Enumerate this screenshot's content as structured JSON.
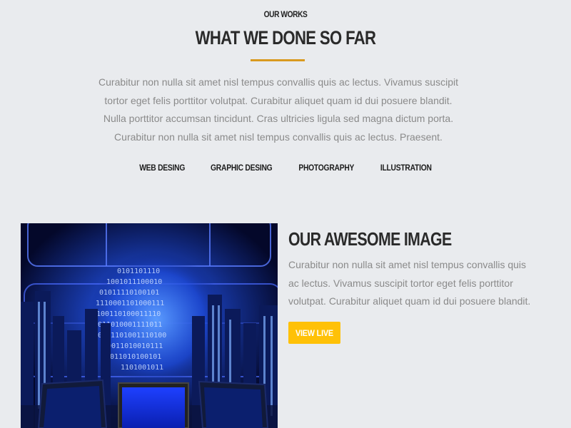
{
  "section": {
    "eyebrow": "OUR WORKS",
    "title": "WHAT WE DONE SO FAR",
    "intro": "Curabitur non nulla sit amet nisl tempus convallis quis ac lectus. Vivamus suscipit tortor eget felis porttitor volutpat. Curabitur aliquet quam id dui posuere blandit. Nulla porttitor accumsan tincidunt. Cras ultricies ligula sed magna dictum porta. Curabitur non nulla sit amet nisl tempus convallis quis ac lectus. Praesent."
  },
  "filters": [
    "WEB DESING",
    "GRAPHIC DESING",
    "PHOTOGRAPHY",
    "ILLUSTRATION"
  ],
  "feature": {
    "title": "OUR AWESOME IMAGE",
    "text": "Curabitur non nulla sit amet nisl tempus convallis quis ac lectus. Vivamus suscipit tortor eget felis porttitor volutpat. Curabitur aliquet quam id dui posuere blandit.",
    "button_label": "VIEW LIVE",
    "image_subject": "digital-city-binary-image"
  },
  "colors": {
    "background": "#e9ebee",
    "accent_underline": "#d99a1f",
    "button": "#ffc107",
    "heading": "#2a2a2a",
    "body_text": "#8a8a8a"
  }
}
